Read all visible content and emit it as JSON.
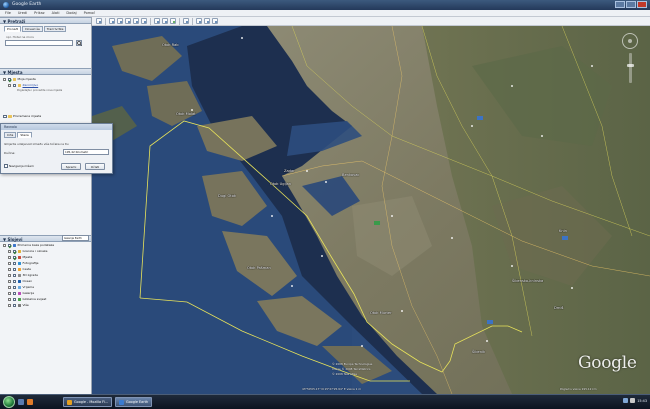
{
  "window": {
    "title": "Google Earth"
  },
  "menu": [
    "File",
    "Uredi",
    "Prikaz",
    "Alati",
    "Dodaj",
    "Pomoć"
  ],
  "search": {
    "header": "Pretraži",
    "tabs": [
      "Pronađi",
      "Dovezi še",
      "Trazi tvrtke"
    ],
    "field_hint": "npr. Hotel na moru",
    "placeholder": ""
  },
  "places": {
    "header": "Mjesta",
    "items": [
      {
        "label": "Moja mjesta",
        "link": false
      },
      {
        "label": "Zanimljivo",
        "link": true
      },
      {
        "label": "Privremena mjesta",
        "link": false
      }
    ],
    "desc": "Pogledajte i pronadite nova mjesta"
  },
  "dialog": {
    "title": "Ravnalo",
    "tabs": [
      "Crta",
      "Staza"
    ],
    "description": "Izmjerite udaljenost između više točaka na tlu",
    "length_label": "Dužina:",
    "length_value": "195,42 Kilometri",
    "checkbox_label": "Navigacija mišem",
    "save_label": "Spremi",
    "clear_label": "Očisti"
  },
  "layers": {
    "header": "Slojevi",
    "gallery_label": "Galerija Earth",
    "items": [
      {
        "label": "Primarna baza podataka",
        "color": "#3e76c9",
        "checked": true
      },
      {
        "label": "Granice i oznake",
        "color": "#e0b23a",
        "checked": true
      },
      {
        "label": "Mjesta",
        "color": "#cc4b3b",
        "checked": true
      },
      {
        "label": "Fotografije",
        "color": "#2f8fd1",
        "checked": false
      },
      {
        "label": "Ceste",
        "color": "#f0a530",
        "checked": false
      },
      {
        "label": "3D zgrade",
        "color": "#8c8c8c",
        "checked": false
      },
      {
        "label": "Ocean",
        "color": "#1e5fae",
        "checked": false
      },
      {
        "label": "Vrijeme",
        "color": "#6aa9e0",
        "checked": false
      },
      {
        "label": "Galerija",
        "color": "#b94bb8",
        "checked": false
      },
      {
        "label": "Globalna svijest",
        "color": "#4aa04a",
        "checked": false
      },
      {
        "label": "Više",
        "color": "#7a7a7a",
        "checked": false
      }
    ]
  },
  "map": {
    "labels": [
      {
        "text": "Otok Molat"
      },
      {
        "text": "Otok Ugljan"
      },
      {
        "text": "Zadar"
      },
      {
        "text": "Benkovac"
      },
      {
        "text": "Dugi Otok"
      },
      {
        "text": "Otok Pašman"
      },
      {
        "text": "Otok Murter"
      },
      {
        "text": "Šibenik"
      },
      {
        "text": "Drniš"
      },
      {
        "text": "Otok Rab"
      },
      {
        "text": "Knin"
      },
      {
        "text": "Šibensko-kninska"
      }
    ],
    "credits": [
      "© 2008 Europa Technologies",
      "Image © 2008 TerraMetrics",
      "© 2008 Tele Atlas"
    ],
    "coords": "43°50'05.17\" N 15°27'25.94\" E visina 1 m",
    "eye_alt": "Pogled s visine 195.12 km",
    "watermark": "Google"
  },
  "taskbar": {
    "tasks": [
      {
        "label": "Google - Mozilla Fi..."
      },
      {
        "label": "Google Earth"
      }
    ],
    "clock": "15:43"
  }
}
